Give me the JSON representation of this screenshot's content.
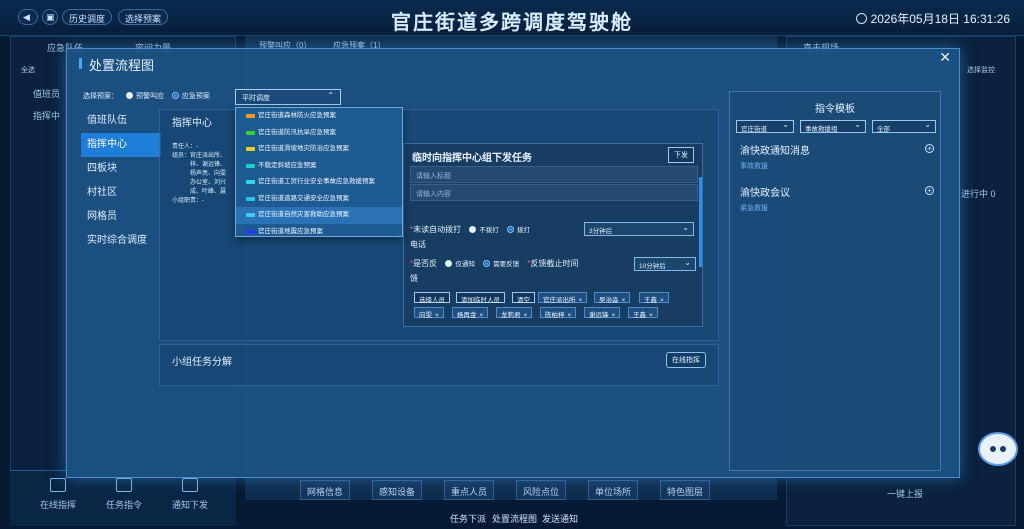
{
  "header": {
    "title": "官庄街道多跨调度驾驶舱",
    "datetime": "2026年05月18日 16:31:26",
    "history_label": "历史调度",
    "select_plan_label": "选择预案"
  },
  "background": {
    "left_tab1": "应急队伍",
    "left_tab2": "容间力量",
    "select_all": "全选",
    "left_row1": "值班员",
    "left_row2": "指挥中",
    "mid_tab1": "预警叫应（0）",
    "mid_tab2": "应急预案（1）",
    "right_title": "直击现场",
    "right_btn": "选择监控",
    "right_progress": "进行中 0",
    "right_report_btn": "一键上报",
    "dock": [
      "在线指挥",
      "任务指令",
      "通知下发"
    ],
    "mid_bottom": [
      "网格信息",
      "感知设备",
      "重点人员",
      "风险点位",
      "单位场所",
      "特色图层"
    ],
    "footer": [
      "任务下派",
      "处置流程图",
      "发送通知"
    ]
  },
  "modal": {
    "title": "处置流程图",
    "plan_label": "选择预案：",
    "radio1": "预警叫应",
    "radio2": "应急预案",
    "plan_value": "平时调度",
    "sidebar": [
      "值班队伍",
      "指挥中心",
      "四板块",
      "村社区",
      "网格员",
      "实时综合调度"
    ],
    "active_index": 1,
    "cmd_title": "指挥中心",
    "resp_lines": [
      "责任人：-",
      "组员：官庄派出所、",
      "　　　梓、谢远锋、",
      "　　　杨声亮、向雯",
      "　　　办公室、刘兴",
      "　　　成、叶峰、聂",
      "小组职责：-"
    ],
    "dropdown": [
      {
        "label": "官庄街道森林防火应急预案",
        "color": "#f29a1c"
      },
      {
        "label": "官庄街道防汛抗旱应急预案",
        "color": "#39d12f"
      },
      {
        "label": "官庄街道滑坡地灾防治应急预案",
        "color": "#e8d11a"
      },
      {
        "label": "不稳定斜坡应急预案",
        "color": "#19d4c9"
      },
      {
        "label": "官庄街道工贸行业安全事故应急救援预案",
        "color": "#2fd7e6"
      },
      {
        "label": "官庄街道道路交通安全应急预案",
        "color": "#21c9e8"
      },
      {
        "label": "官庄街道自然灾害救助应急预案",
        "color": "#3bd0f0"
      },
      {
        "label": "官庄街道地震应急预案",
        "color": "#2b35ff"
      }
    ],
    "task": {
      "title": "临时向指挥中心组下发任务",
      "issue_btn": "下发",
      "title_ph": "请输入标题",
      "content_ph": "请输入内容",
      "call_label_a": "未读自动拨打",
      "call_label_b": "电话",
      "no_call": "不拨打",
      "call": "拨打",
      "call_delay": "3分钟后",
      "fb_label_a": "是否反",
      "fb_label_b": "馈",
      "only_notify": "仅通知",
      "need_fb": "需要反馈",
      "fb_deadline": "反馈截止时间",
      "fb_delay": "10分钟后",
      "buttons": [
        "选择人员",
        "添加临时人员",
        "清空"
      ],
      "tags": [
        "官庄派出所",
        "吴治淼",
        "王鑫",
        "向雯",
        "杨再金",
        "龙莉君",
        "陈柏梓",
        "谢远锋",
        "王鑫"
      ]
    },
    "subtask_title": "小组任务分解",
    "online_btn": "在线指挥",
    "template": {
      "title": "指令模板",
      "sel1": "官庄街道",
      "sel2": "事故救援组",
      "sel3": "全部",
      "items": [
        {
          "title": "渝快政通知消息",
          "sub": "事故救援"
        },
        {
          "title": "渝快政会议",
          "sub": "紧急救援"
        }
      ]
    }
  }
}
